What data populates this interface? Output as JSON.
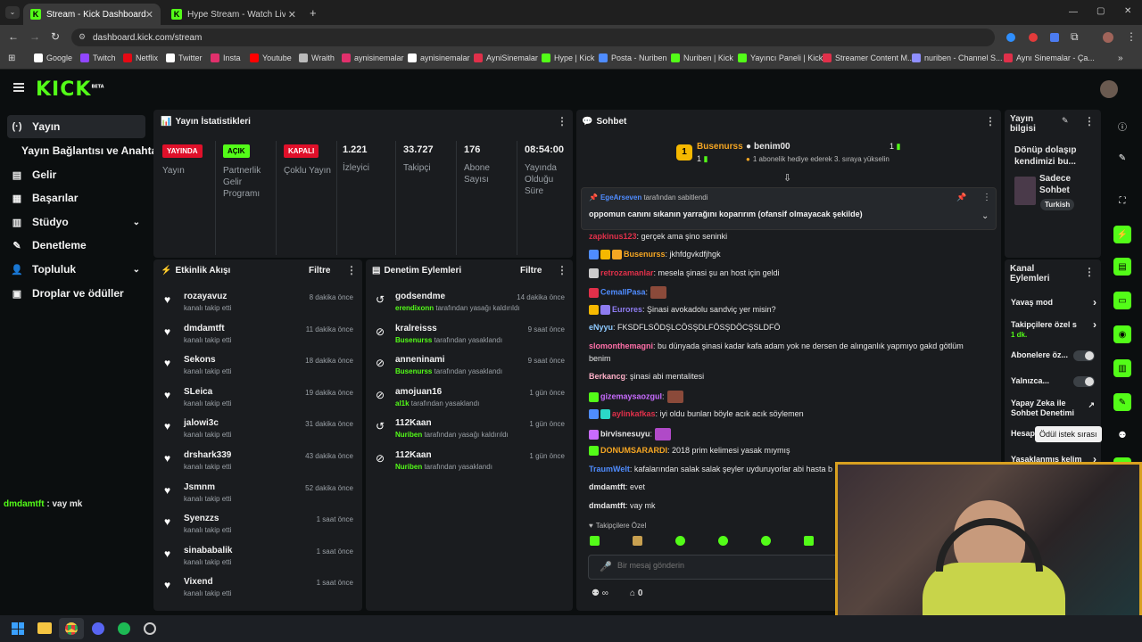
{
  "browser": {
    "tabs": [
      {
        "title": "Stream - Kick Dashboard",
        "active": true
      },
      {
        "title": "Hype Stream - Watch Live on Kick",
        "active": false
      }
    ],
    "url": "dashboard.kick.com/stream",
    "bookmarks": [
      "Google",
      "Twitch",
      "Netflix",
      "Twitter",
      "Insta",
      "Youtube",
      "Wraith",
      "aynisinemalar",
      "aynisinemalar",
      "AyniSinemalar",
      "Hype | Kick",
      "Posta - Nuriben",
      "Nuriben | Kick",
      "Yayıncı Paneli | Kick",
      "Streamer Content M...",
      "nuriben - Channel S...",
      "Aynı Sinemalar - Ça..."
    ]
  },
  "brand": {
    "logo": "KICK",
    "beta": "BETA"
  },
  "sidebar": [
    {
      "label": "Yayın",
      "icon": "(·)",
      "active": true
    },
    {
      "label": "Yayın Bağlantısı ve Anahtarı",
      "icon": ""
    },
    {
      "label": "Gelir",
      "icon": "▤"
    },
    {
      "label": "Başarılar",
      "icon": "▦"
    },
    {
      "label": "Stüdyo",
      "icon": "▥",
      "chevron": true
    },
    {
      "label": "Denetleme",
      "icon": "✎"
    },
    {
      "label": "Topluluk",
      "icon": "👤",
      "chevron": true
    },
    {
      "label": "Droplar ve ödüller",
      "icon": "▣"
    }
  ],
  "overlay_chat_line": {
    "user": "dmdamtft",
    "text": " : vay mk"
  },
  "stats": {
    "title": "Yayın İstatistikleri",
    "cols": [
      {
        "badge": "YAYINDA",
        "label": "Yayın",
        "badge_color": "#e0102a"
      },
      {
        "badge": "AÇIK",
        "label": "Partnerlik Gelir Programı",
        "badge_color": "#53fc18"
      },
      {
        "badge": "KAPALI",
        "label": "Çoklu Yayın",
        "badge_color": "#e0102a"
      },
      {
        "value": "1.221",
        "label": "İzleyici"
      },
      {
        "value": "33.727",
        "label": "Takipçi"
      },
      {
        "value": "176",
        "label": "Abone Sayısı"
      },
      {
        "value": "08:54:00",
        "label": "Yayında Olduğu Süre"
      }
    ]
  },
  "activity": {
    "title": "Etkinlik Akışı",
    "filter": "Filtre",
    "items": [
      {
        "name": "rozayavuz",
        "sub": "kanalı takip etti",
        "time": "8 dakika önce"
      },
      {
        "name": "dmdamtft",
        "sub": "kanalı takip etti",
        "time": "11 dakika önce"
      },
      {
        "name": "Sekons",
        "sub": "kanalı takip etti",
        "time": "18 dakika önce"
      },
      {
        "name": "SLeica",
        "sub": "kanalı takip etti",
        "time": "19 dakika önce"
      },
      {
        "name": "jalowi3c",
        "sub": "kanalı takip etti",
        "time": "31 dakika önce"
      },
      {
        "name": "drshark339",
        "sub": "kanalı takip etti",
        "time": "43 dakika önce"
      },
      {
        "name": "Jsmnm",
        "sub": "kanalı takip etti",
        "time": "52 dakika önce"
      },
      {
        "name": "Syenzzs",
        "sub": "kanalı takip etti",
        "time": "1 saat önce"
      },
      {
        "name": "sinababalik",
        "sub": "kanalı takip etti",
        "time": "1 saat önce"
      },
      {
        "name": "Vixend",
        "sub": "kanalı takip etti",
        "time": "1 saat önce"
      }
    ]
  },
  "moderation": {
    "title": "Denetim Eylemleri",
    "filter": "Filtre",
    "items": [
      {
        "name": "godsendme",
        "by": "erendixonn",
        "action": " tarafından yasağı kaldırıldı",
        "time": "14 dakika önce",
        "icon": "↺"
      },
      {
        "name": "kralreisss",
        "by": "Busenurss",
        "action": " tarafından yasaklandı",
        "time": "9 saat önce",
        "icon": "⊘"
      },
      {
        "name": "anneninami",
        "by": "Busenurss",
        "action": " tarafından yasaklandı",
        "time": "9 saat önce",
        "icon": "⊘"
      },
      {
        "name": "amojuan16",
        "by": "al1k",
        "action": " tarafından yasaklandı",
        "time": "1 gün önce",
        "icon": "⊘"
      },
      {
        "name": "112Kaan",
        "by": "Nuriben",
        "action": " tarafından yasağı kaldırıldı",
        "time": "1 gün önce",
        "icon": "↺"
      },
      {
        "name": "112Kaan",
        "by": "Nuriben",
        "action": " tarafından yasaklandı",
        "time": "1 gün önce",
        "icon": "⊘"
      }
    ]
  },
  "chat": {
    "title": "Sohbet",
    "sub_banner": {
      "user1": "Busenurss",
      "count1": "1",
      "user2": "benim00",
      "count2": "1",
      "text": "1 abonelik hediye ederek 3. sıraya yükselin"
    },
    "pinned": {
      "by": "EgeArseven",
      "by_suffix": " tarafından sabitlendi",
      "text": "oppomun canını sıkanın yarrağını koparırım (ofansif olmayacak şekilde)"
    },
    "messages": [
      {
        "user": "zapkinus123",
        "color": "#e0304a",
        "text": ": gerçek ama şino seninki"
      },
      {
        "user": "Busenurss",
        "color": "#f5a623",
        "text": ": jkhfdgvkdfjhgk"
      },
      {
        "user": "retrozamanlar",
        "color": "#e0304a",
        "text": ": mesela şinasi şu an host için geldi"
      },
      {
        "user": "CemallPasa",
        "color": "#4f8cff",
        "text": ":"
      },
      {
        "user": "Eurores",
        "color": "#8e7cf0",
        "text": ": Şinasi avokadolu sandviç yer misin?"
      },
      {
        "user": "eNyyu",
        "color": "#8ecaff",
        "text": ": FKSDFLSÖDŞLCÖSŞDLFÖSŞDÖCŞSLDFÖ"
      },
      {
        "user": "slomonthemagni",
        "color": "#ff6fa8",
        "text": ": bu dünyada şinasi kadar kafa adam yok ne dersen de alınganlık yapmıyo gakd götlüm"
      },
      {
        "user": "",
        "color": "#e6e6e6",
        "text": "benim"
      },
      {
        "user": "Berkancg",
        "color": "#ffb0c8",
        "text": ": şinasi abi mentalitesi"
      },
      {
        "user": "gizemaysaozgul",
        "color": "#c86bff",
        "text": ":"
      },
      {
        "user": "aylinkafkas",
        "color": "#e0304a",
        "text": ": iyi oldu bunları böyle acık acık söylemen"
      },
      {
        "user": "birvisnesuyu",
        "color": "#e6e6e6",
        "text": ":"
      },
      {
        "user": "DONUMSARARDI",
        "color": "#f5a623",
        "text": ": 2018 prim kelimesi yasak mıymış"
      },
      {
        "user": "TraumWelt",
        "color": "#4f8cff",
        "text": ": kafalarından salak salak şeyler uyduruyorlar abi hasta b"
      },
      {
        "user": "dmdamtft",
        "color": "#e6e6e6",
        "text": ": evet"
      },
      {
        "user": "dmdamtft",
        "color": "#e6e6e6",
        "text": ": vay mk"
      }
    ],
    "followers_only": "Takipçilere Özel",
    "input_placeholder": "Bir mesaj gönderin",
    "footer_count": "0"
  },
  "stream_info": {
    "title": "Yayın bilgisi",
    "desc": "Dönüp dolaşıp kendimizi bu...",
    "category": "Sadece Sohbet",
    "tag": "Turkish"
  },
  "channel_actions": {
    "title": "Kanal Eylemleri",
    "items": [
      {
        "label": "Yavaş mod",
        "type": "chevron"
      },
      {
        "label": "Takipçilere özel s",
        "sub": "1 dk.",
        "type": "chevron"
      },
      {
        "label": "Abonelere öz...",
        "type": "toggle"
      },
      {
        "label": "Yalnızca...",
        "type": "toggle"
      },
      {
        "label": "Yapay Zeka ile Sohbet Denetimi",
        "type": "link"
      },
      {
        "label": "Hesap",
        "type": ""
      },
      {
        "label": "Yasaklanmış kelim",
        "type": "chevron"
      }
    ],
    "tooltip": "Ödül istek sırası"
  },
  "colors": {
    "brand": "#53fc18",
    "live": "#e0102a",
    "panel": "#1a1c1f",
    "bg": "#0b0e0f"
  }
}
